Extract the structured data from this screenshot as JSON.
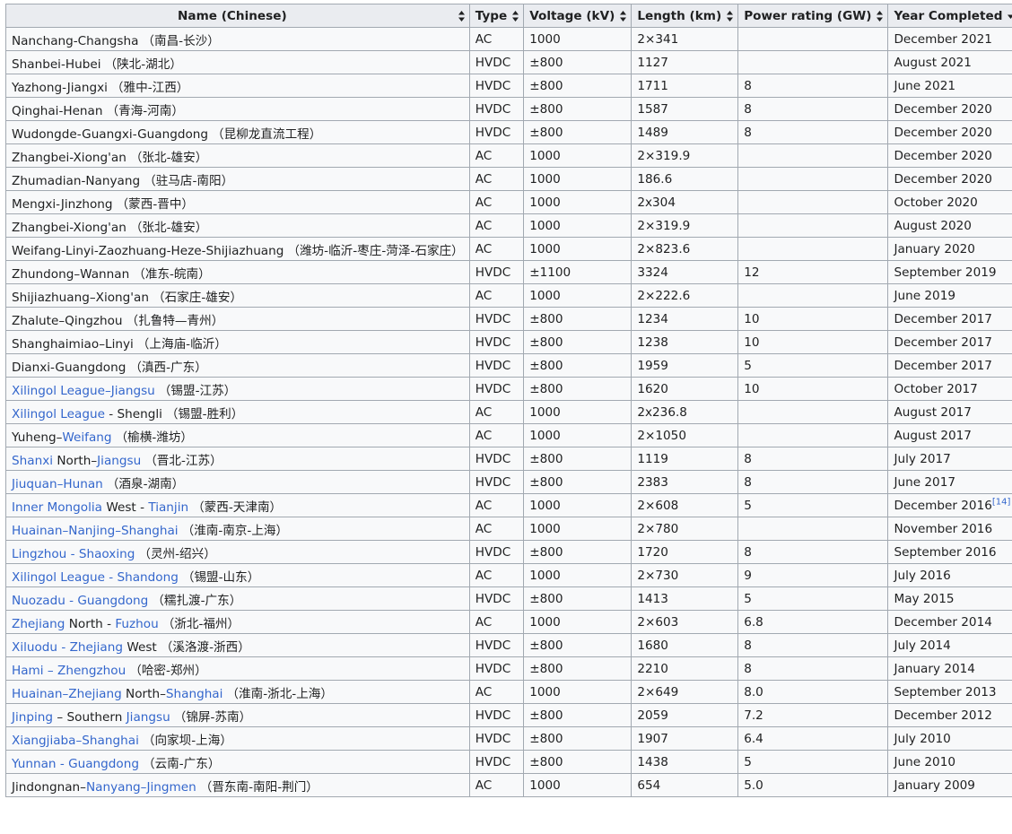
{
  "table": {
    "headers": [
      {
        "label": "Name (Chinese)",
        "sort": "both"
      },
      {
        "label": "Type",
        "sort": "both"
      },
      {
        "label": "Voltage (kV)",
        "sort": "both"
      },
      {
        "label": "Length (km)",
        "sort": "both"
      },
      {
        "label": "Power rating (GW)",
        "sort": "both"
      },
      {
        "label": "Year Completed",
        "sort": "desc"
      }
    ],
    "rows": [
      {
        "name": [
          {
            "t": "Nanchang-Changsha"
          }
        ],
        "zh": "（南昌-长沙）",
        "type": "AC",
        "voltage": "1000",
        "length": "2×341",
        "power": "",
        "year": "December 2021"
      },
      {
        "name": [
          {
            "t": "Shanbei-Hubei"
          }
        ],
        "zh": "（陕北-湖北）",
        "type": "HVDC",
        "voltage": "±800",
        "length": "1127",
        "power": "",
        "year": "August 2021"
      },
      {
        "name": [
          {
            "t": "Yazhong-Jiangxi"
          }
        ],
        "zh": "（雅中-江西）",
        "type": "HVDC",
        "voltage": "±800",
        "length": "1711",
        "power": "8",
        "year": "June 2021"
      },
      {
        "name": [
          {
            "t": "Qinghai-Henan"
          }
        ],
        "zh": "（青海-河南）",
        "type": "HVDC",
        "voltage": "±800",
        "length": "1587",
        "power": "8",
        "year": "December 2020"
      },
      {
        "name": [
          {
            "t": "Wudongde-Guangxi-Guangdong"
          }
        ],
        "zh": "（昆柳龙直流工程）",
        "type": "HVDC",
        "voltage": "±800",
        "length": "1489",
        "power": "8",
        "year": "December 2020"
      },
      {
        "name": [
          {
            "t": "Zhangbei-Xiong'an"
          }
        ],
        "zh": "（张北-雄安）",
        "type": "AC",
        "voltage": "1000",
        "length": "2×319.9",
        "power": "",
        "year": "December 2020"
      },
      {
        "name": [
          {
            "t": "Zhumadian-Nanyang"
          }
        ],
        "zh": "（驻马店-南阳）",
        "type": "AC",
        "voltage": "1000",
        "length": "186.6",
        "power": "",
        "year": "December 2020"
      },
      {
        "name": [
          {
            "t": "Mengxi-Jinzhong"
          }
        ],
        "zh": "（蒙西-晋中）",
        "type": "AC",
        "voltage": "1000",
        "length": "2x304",
        "power": "",
        "year": "October 2020"
      },
      {
        "name": [
          {
            "t": "Zhangbei-Xiong'an"
          }
        ],
        "zh": "（张北-雄安）",
        "type": "AC",
        "voltage": "1000",
        "length": "2×319.9",
        "power": "",
        "year": "August 2020"
      },
      {
        "name": [
          {
            "t": "Weifang-Linyi-Zaozhuang-Heze-Shijiazhuang"
          }
        ],
        "zh": "（潍坊-临沂-枣庄-菏泽-石家庄）",
        "type": "AC",
        "voltage": "1000",
        "length": "2×823.6",
        "power": "",
        "year": "January 2020"
      },
      {
        "name": [
          {
            "t": "Zhundong–Wannan"
          }
        ],
        "zh": "（准东-皖南）",
        "type": "HVDC",
        "voltage": "±1100",
        "length": "3324",
        "power": "12",
        "year": "September 2019"
      },
      {
        "name": [
          {
            "t": "Shijiazhuang–Xiong'an"
          }
        ],
        "zh": "（石家庄-雄安）",
        "type": "AC",
        "voltage": "1000",
        "length": "2×222.6",
        "power": "",
        "year": "June 2019"
      },
      {
        "name": [
          {
            "t": "Zhalute–Qingzhou"
          }
        ],
        "zh": "（扎鲁特—青州）",
        "type": "HVDC",
        "voltage": "±800",
        "length": "1234",
        "power": "10",
        "year": "December 2017"
      },
      {
        "name": [
          {
            "t": "Shanghaimiao–Linyi"
          }
        ],
        "zh": "（上海庙-临沂）",
        "type": "HVDC",
        "voltage": "±800",
        "length": "1238",
        "power": "10",
        "year": "December 2017"
      },
      {
        "name": [
          {
            "t": "Dianxi-Guangdong"
          }
        ],
        "zh": "（滇西-广东）",
        "type": "HVDC",
        "voltage": "±800",
        "length": "1959",
        "power": "5",
        "year": "December 2017"
      },
      {
        "name": [
          {
            "t": "Xilingol League–Jiangsu",
            "link": true
          }
        ],
        "zh": "（锡盟-江苏）",
        "type": "HVDC",
        "voltage": "±800",
        "length": "1620",
        "power": "10",
        "year": "October 2017"
      },
      {
        "name": [
          {
            "t": "Xilingol League",
            "link": true
          },
          {
            "t": " - Shengli"
          }
        ],
        "zh": "（锡盟-胜利）",
        "type": "AC",
        "voltage": "1000",
        "length": "2x236.8",
        "power": "",
        "year": "August 2017"
      },
      {
        "name": [
          {
            "t": "Yuheng–"
          },
          {
            "t": "Weifang",
            "link": true
          }
        ],
        "zh": "（榆横-潍坊）",
        "type": "AC",
        "voltage": "1000",
        "length": "2×1050",
        "power": "",
        "year": "August 2017"
      },
      {
        "name": [
          {
            "t": "Shanxi",
            "link": true
          },
          {
            "t": " North–"
          },
          {
            "t": "Jiangsu",
            "link": true
          }
        ],
        "zh": "（晋北-江苏）",
        "type": "HVDC",
        "voltage": "±800",
        "length": "1119",
        "power": "8",
        "year": "July 2017"
      },
      {
        "name": [
          {
            "t": "Jiuquan–Hunan",
            "link": true
          }
        ],
        "zh": "（酒泉-湖南）",
        "type": "HVDC",
        "voltage": "±800",
        "length": "2383",
        "power": "8",
        "year": "June 2017"
      },
      {
        "name": [
          {
            "t": "Inner Mongolia",
            "link": true
          },
          {
            "t": " West - "
          },
          {
            "t": "Tianjin",
            "link": true
          }
        ],
        "zh": "（蒙西-天津南）",
        "type": "AC",
        "voltage": "1000",
        "length": "2×608",
        "power": "5",
        "year": "December 2016",
        "ref": "[14]"
      },
      {
        "name": [
          {
            "t": "Huainan–Nanjing–Shanghai",
            "link": true
          }
        ],
        "zh": "（淮南-南京-上海）",
        "type": "AC",
        "voltage": "1000",
        "length": "2×780",
        "power": "",
        "year": "November 2016"
      },
      {
        "name": [
          {
            "t": "Lingzhou - Shaoxing",
            "link": true
          }
        ],
        "zh": "（灵州-绍兴）",
        "type": "HVDC",
        "voltage": "±800",
        "length": "1720",
        "power": "8",
        "year": "September 2016"
      },
      {
        "name": [
          {
            "t": "Xilingol League - Shandong",
            "link": true
          }
        ],
        "zh": "（锡盟-山东）",
        "type": "AC",
        "voltage": "1000",
        "length": "2×730",
        "power": "9",
        "year": "July 2016"
      },
      {
        "name": [
          {
            "t": "Nuozadu - Guangdong",
            "link": true
          }
        ],
        "zh": "（糯扎渡-广东）",
        "type": "HVDC",
        "voltage": "±800",
        "length": "1413",
        "power": "5",
        "year": "May 2015"
      },
      {
        "name": [
          {
            "t": "Zhejiang",
            "link": true
          },
          {
            "t": " North - "
          },
          {
            "t": "Fuzhou",
            "link": true
          }
        ],
        "zh": "（浙北-福州）",
        "type": "AC",
        "voltage": "1000",
        "length": "2×603",
        "power": "6.8",
        "year": "December 2014"
      },
      {
        "name": [
          {
            "t": "Xiluodu - Zhejiang",
            "link": true
          },
          {
            "t": " West"
          }
        ],
        "zh": "（溪洛渡-浙西）",
        "type": "HVDC",
        "voltage": "±800",
        "length": "1680",
        "power": "8",
        "year": "July 2014"
      },
      {
        "name": [
          {
            "t": "Hami – Zhengzhou",
            "link": true
          }
        ],
        "zh": "（哈密-郑州）",
        "type": "HVDC",
        "voltage": "±800",
        "length": "2210",
        "power": "8",
        "year": "January 2014"
      },
      {
        "name": [
          {
            "t": "Huainan–Zhejiang",
            "link": true
          },
          {
            "t": " North–"
          },
          {
            "t": "Shanghai",
            "link": true
          }
        ],
        "zh": "（淮南-浙北-上海）",
        "type": "AC",
        "voltage": "1000",
        "length": "2×649",
        "power": "8.0",
        "year": "September 2013"
      },
      {
        "name": [
          {
            "t": "Jinping",
            "link": true
          },
          {
            "t": " – Southern "
          },
          {
            "t": "Jiangsu",
            "link": true
          }
        ],
        "zh": "（锦屏-苏南）",
        "type": "HVDC",
        "voltage": "±800",
        "length": "2059",
        "power": "7.2",
        "year": "December 2012"
      },
      {
        "name": [
          {
            "t": "Xiangjiaba–Shanghai",
            "link": true
          }
        ],
        "zh": "（向家坝-上海）",
        "type": "HVDC",
        "voltage": "±800",
        "length": "1907",
        "power": "6.4",
        "year": "July 2010"
      },
      {
        "name": [
          {
            "t": "Yunnan - Guangdong",
            "link": true
          }
        ],
        "zh": "（云南-广东）",
        "type": "HVDC",
        "voltage": "±800",
        "length": "1438",
        "power": "5",
        "year": "June 2010"
      },
      {
        "name": [
          {
            "t": "Jindongnan–"
          },
          {
            "t": "Nanyang–Jingmen",
            "link": true
          }
        ],
        "zh": "（晋东南-南阳-荆门）",
        "type": "AC",
        "voltage": "1000",
        "length": "654",
        "power": "5.0",
        "year": "January 2009"
      }
    ]
  },
  "colors": {
    "link": "#3366cc",
    "header_bg": "#eaecf0",
    "cell_bg": "#f8f9fa",
    "border": "#a2a9b1",
    "text": "#202122"
  }
}
